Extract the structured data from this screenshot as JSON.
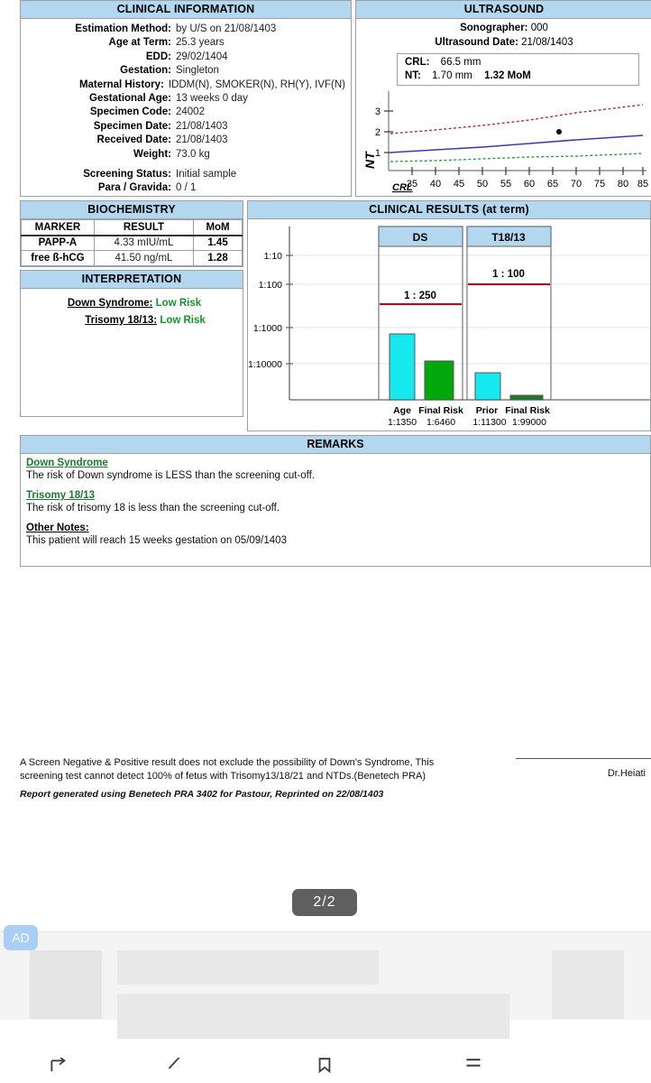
{
  "clinical_information": {
    "title": "CLINICAL INFORMATION",
    "fields": [
      {
        "label": "Estimation Method:",
        "value": "by U/S on 21/08/1403"
      },
      {
        "label": "Age at Term:",
        "value": "25.3 years"
      },
      {
        "label": "EDD:",
        "value": "29/02/1404"
      },
      {
        "label": "Gestation:",
        "value": "Singleton"
      },
      {
        "label": "Maternal History:",
        "value": "IDDM(N), SMOKER(N), RH(Y), IVF(N)"
      },
      {
        "label": "Gestational Age:",
        "value": "13 weeks 0 day"
      },
      {
        "label": "Specimen Code:",
        "value": "24002"
      },
      {
        "label": "Specimen Date:",
        "value": "21/08/1403"
      },
      {
        "label": "Received Date:",
        "value": "21/08/1403"
      },
      {
        "label": "Weight:",
        "value": "73.0 kg"
      }
    ],
    "fields2": [
      {
        "label": "Screening Status:",
        "value": "Initial sample"
      },
      {
        "label": "Para / Gravida:",
        "value": "0 / 1"
      }
    ]
  },
  "ultrasound": {
    "title": "ULTRASOUND",
    "sonographer_label": "Sonographer:",
    "sonographer_value": "000",
    "date_label": "Ultrasound Date:",
    "date_value": "21/08/1403",
    "crl_label": "CRL:",
    "crl_value": "66.5",
    "crl_unit": "mm",
    "nt_label": "NT:",
    "nt_value": "1.70",
    "nt_unit": "mm",
    "nt_mom": "1.32 MoM"
  },
  "biochemistry": {
    "title": "BIOCHEMISTRY",
    "columns": [
      "MARKER",
      "RESULT",
      "MoM"
    ],
    "rows": [
      {
        "marker": "PAPP-A",
        "result": "4.33 mIU/mL",
        "mom": "1.45"
      },
      {
        "marker": "free ß-hCG",
        "result": "41.50 ng/mL",
        "mom": "1.28"
      }
    ]
  },
  "interpretation": {
    "title": "INTERPRETATION",
    "rows": [
      {
        "label": "Down Syndrome:",
        "value": "Low Risk"
      },
      {
        "label": "Trisomy 18/13:",
        "value": "Low Risk"
      }
    ]
  },
  "clinical_results": {
    "title": "CLINICAL RESULTS (at term)"
  },
  "remarks": {
    "title": "REMARKS",
    "blocks": [
      {
        "heading": "Down Syndrome",
        "text": "The risk of Down syndrome is LESS than the screening cut-off."
      },
      {
        "heading": "Trisomy 18/13",
        "text": "The risk of trisomy 18 is less than the screening cut-off."
      },
      {
        "heading": "Other Notes:",
        "text": "This patient will reach 15 weeks gestation on 05/09/1403"
      }
    ]
  },
  "footer": {
    "disclaimer_line1": "A Screen Negative & Positive result does not exclude the possibility of Down's Syndrome, This",
    "disclaimer_line2": "screening test cannot detect 100% of fetus with Trisomy13/18/21 and NTDs.(Benetech PRA)",
    "generated": "Report generated using Benetech PRA 3402 for Pastour, Reprinted on 22/08/1403",
    "signature_name": "Dr.Heiati"
  },
  "viewer": {
    "page_indicator": "2/2",
    "ad_badge": "AD",
    "nav_items": [
      {
        "name": "share-icon"
      },
      {
        "name": "edit-icon"
      },
      {
        "name": "bookmark-icon"
      },
      {
        "name": "menu-icon"
      }
    ]
  },
  "colors": {
    "header_blue": "#b4d7f0",
    "cyan_bar": "#16e8ef",
    "green_bar": "#00a80c",
    "cutoff_red": "#a01520",
    "low_risk_green": "#119626"
  },
  "chart_data": [
    {
      "type": "line",
      "name": "nt-vs-crl",
      "title": "",
      "xlabel": "CRL",
      "ylabel": "NT",
      "xlim": [
        31,
        86
      ],
      "ylim": [
        0,
        3.6
      ],
      "xticks": [
        35,
        40,
        45,
        50,
        55,
        60,
        65,
        70,
        75,
        80,
        85
      ],
      "yticks": [
        1,
        2,
        3
      ],
      "grid": false,
      "series": [
        {
          "name": "upper-limit",
          "style": "dotted",
          "color": "#a8333a",
          "x": [
            31,
            40,
            50,
            60,
            70,
            84
          ],
          "y": [
            1.78,
            1.95,
            2.18,
            2.45,
            2.78,
            3.2
          ]
        },
        {
          "name": "median",
          "style": "solid",
          "color": "#3b3bb0",
          "x": [
            31,
            40,
            50,
            60,
            70,
            84
          ],
          "y": [
            0.86,
            0.98,
            1.14,
            1.3,
            1.46,
            1.68
          ]
        },
        {
          "name": "lower-limit",
          "style": "dotted",
          "color": "#2f9e3f",
          "x": [
            31,
            40,
            50,
            60,
            70,
            84
          ],
          "y": [
            0.45,
            0.5,
            0.57,
            0.64,
            0.71,
            0.82
          ]
        }
      ],
      "points": [
        {
          "name": "patient",
          "x": 66.5,
          "y": 1.88,
          "color": "#000000"
        }
      ]
    },
    {
      "type": "bar",
      "name": "clinical-risk-at-term",
      "title": "CLINICAL RESULTS (at term)",
      "ylabel": "",
      "yticks": [
        "1:10",
        "1:100",
        "1:1000",
        "1:10000"
      ],
      "ylog_decades": [
        10,
        100,
        1000,
        10000
      ],
      "groups": [
        {
          "name": "DS",
          "header": "DS",
          "cutoff_label": "1 : 250",
          "cutoff_value": 250,
          "bars": [
            {
              "label": "Age",
              "value_label": "1:1350",
              "value": 1350,
              "color": "#16e8ef"
            },
            {
              "label": "Final Risk",
              "value_label": "1:6460",
              "value": 6460,
              "color": "#00a80c"
            }
          ]
        },
        {
          "name": "T18/13",
          "header": "T18/13",
          "cutoff_label": "1 : 100",
          "cutoff_value": 100,
          "bars": [
            {
              "label": "Prior",
              "value_label": "1:11300",
              "value": 11300,
              "color": "#16e8ef"
            },
            {
              "label": "Final Risk",
              "value_label": "1:99000",
              "value": 99000,
              "color": "#00a80c"
            }
          ]
        }
      ]
    }
  ]
}
